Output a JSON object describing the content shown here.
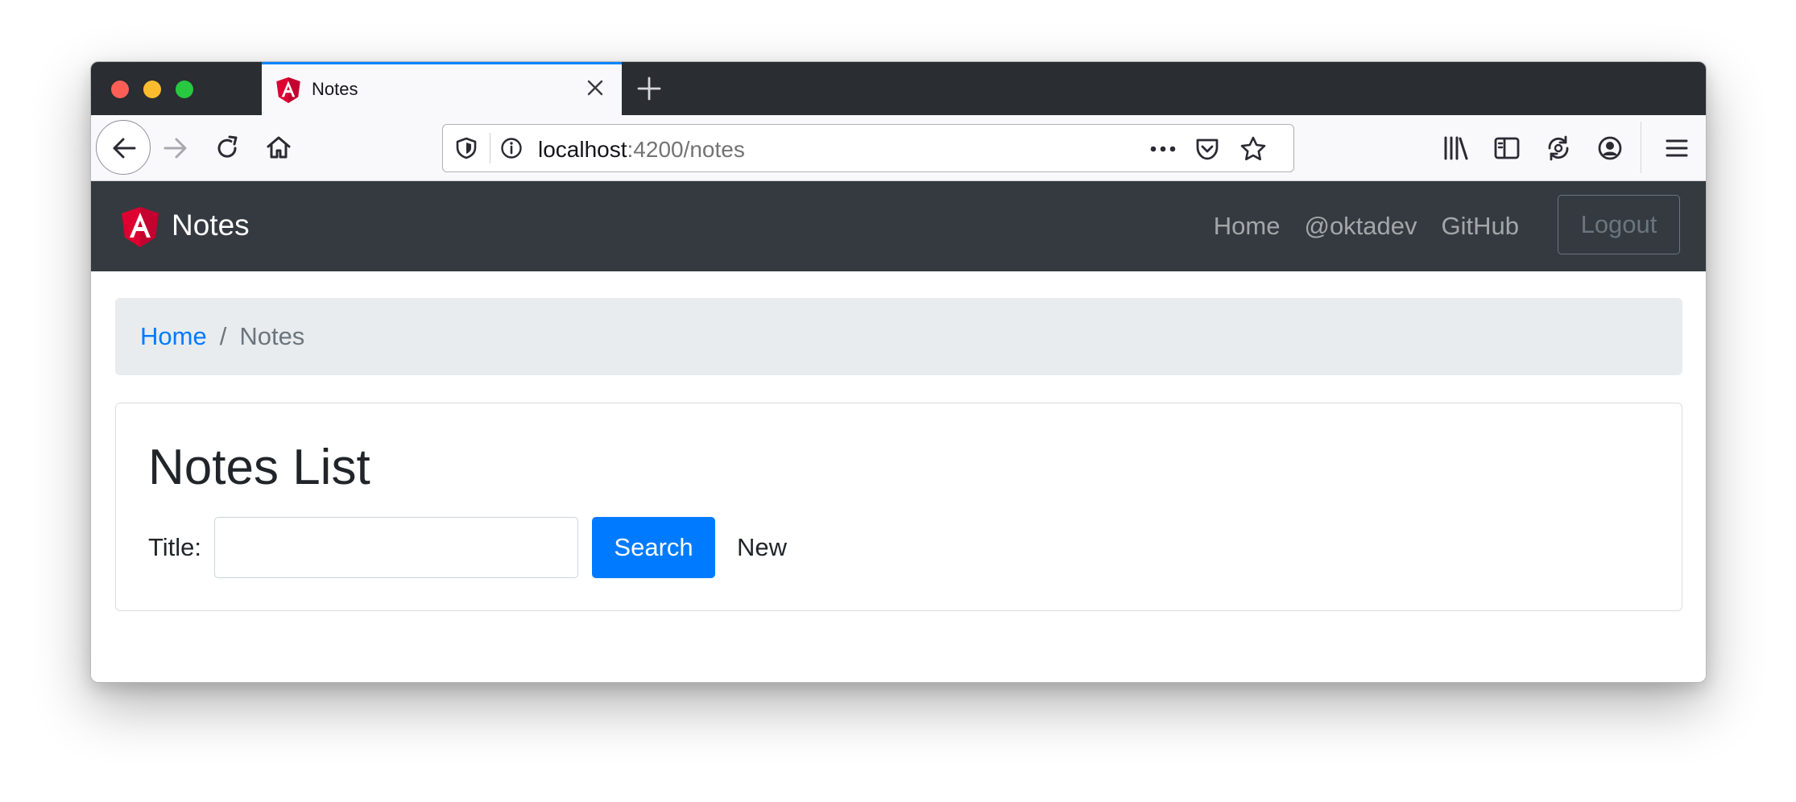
{
  "browser": {
    "tab": {
      "title": "Notes",
      "favicon": "angular-icon"
    },
    "url": {
      "host": "localhost",
      "rest": ":4200/notes"
    }
  },
  "navbar": {
    "brand": "Notes",
    "links": [
      "Home",
      "@oktadev",
      "GitHub"
    ],
    "logout_label": "Logout"
  },
  "breadcrumb": {
    "home": "Home",
    "separator": "/",
    "current": "Notes"
  },
  "notes": {
    "heading": "Notes List",
    "title_label": "Title:",
    "title_value": "",
    "search_label": "Search",
    "new_label": "New"
  },
  "colors": {
    "navbar": "#343a40",
    "primary": "#007bff",
    "breadcrumb_bg": "#e9ecef",
    "tab_accent": "#0a84ff",
    "angular_red": "#dd0031"
  }
}
